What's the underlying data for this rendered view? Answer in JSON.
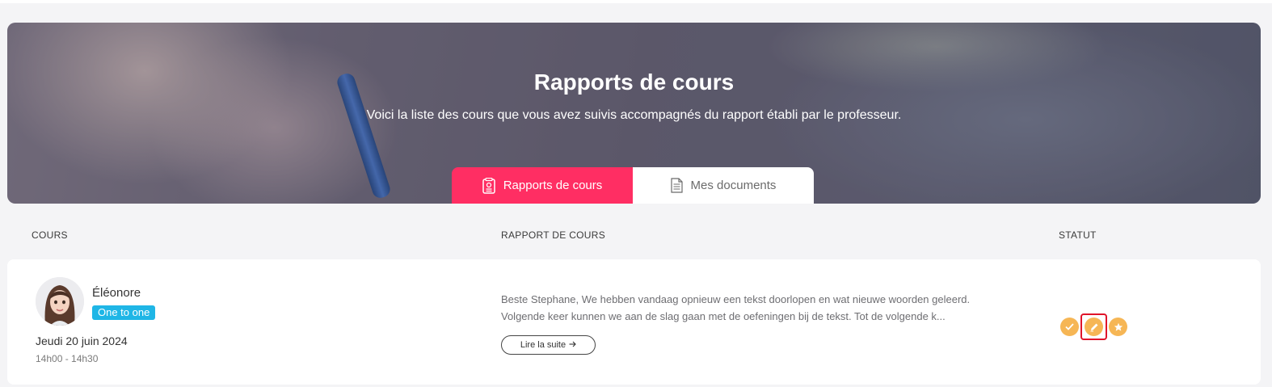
{
  "hero": {
    "title": "Rapports de cours",
    "subtitle": "Voici la liste des cours que vous avez suivis accompagnés du rapport établi par le professeur."
  },
  "tabs": [
    {
      "label": "Rapports de cours",
      "icon": "report-icon",
      "active": true
    },
    {
      "label": "Mes documents",
      "icon": "document-icon",
      "active": false
    }
  ],
  "columns": {
    "course": "COURS",
    "report": "RAPPORT DE COURS",
    "status": "STATUT"
  },
  "lesson": {
    "teacher": "Éléonore",
    "type": "One to one",
    "date": "Jeudi 20 juin 2024",
    "time": "14h00 - 14h30",
    "report_line1": "Beste Stephane, We hebben vandaag opnieuw een tekst doorlopen en wat nieuwe woorden geleerd.",
    "report_line2": "Volgende keer kunnen we aan de slag gaan met de oefeningen bij de tekst. Tot de volgende k...",
    "read_more": "Lire la suite",
    "status_icons": [
      "check-icon",
      "pencil-icon",
      "star-icon"
    ]
  },
  "colors": {
    "accent": "#ff2e63",
    "badge": "#1fb6e6",
    "status": "#f6b655",
    "highlight": "#e0142a"
  }
}
